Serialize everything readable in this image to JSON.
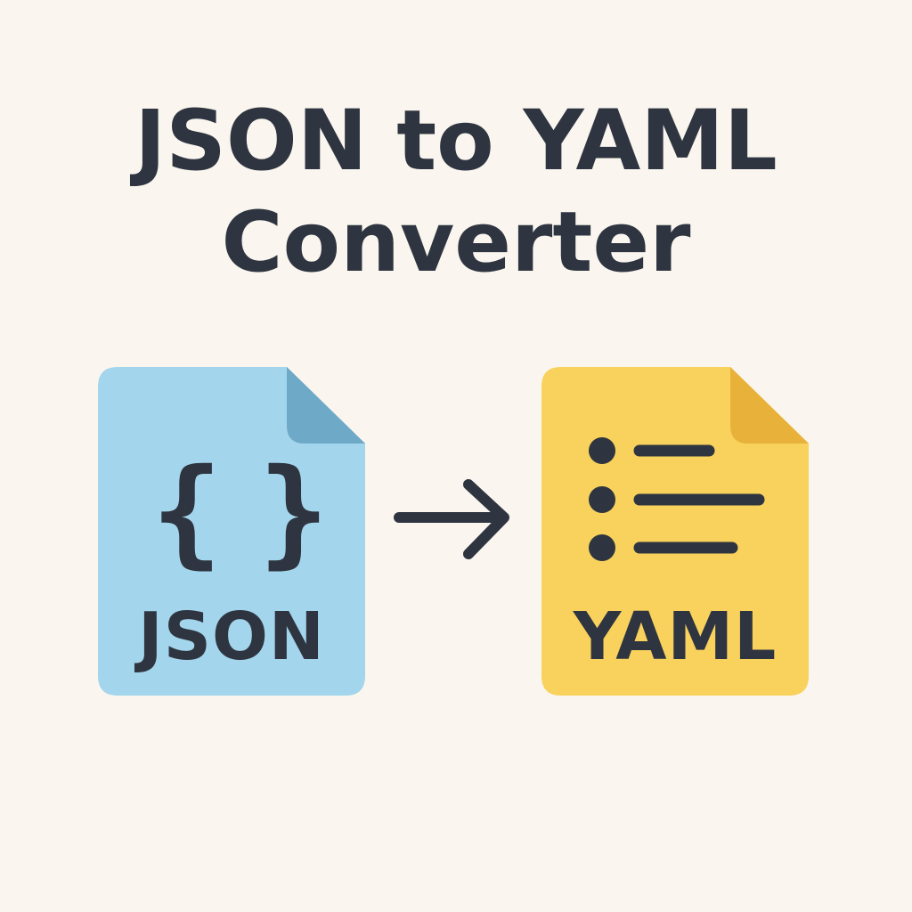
{
  "title": {
    "line1": "JSON to YAML",
    "line2": "Converter"
  },
  "source_file": {
    "label": "JSON",
    "brace_open": "{",
    "brace_close": "}",
    "icon": "json-file-icon",
    "color": "#a3d5ec",
    "fold_color": "#6fa9c8"
  },
  "target_file": {
    "label": "YAML",
    "icon": "yaml-file-icon",
    "list_icon": "bulleted-list-icon",
    "color": "#f8d25c",
    "fold_color": "#e8b23a"
  },
  "arrow": {
    "icon": "arrow-right-icon"
  },
  "colors": {
    "background": "#faf6ef",
    "text": "#2f3540"
  }
}
